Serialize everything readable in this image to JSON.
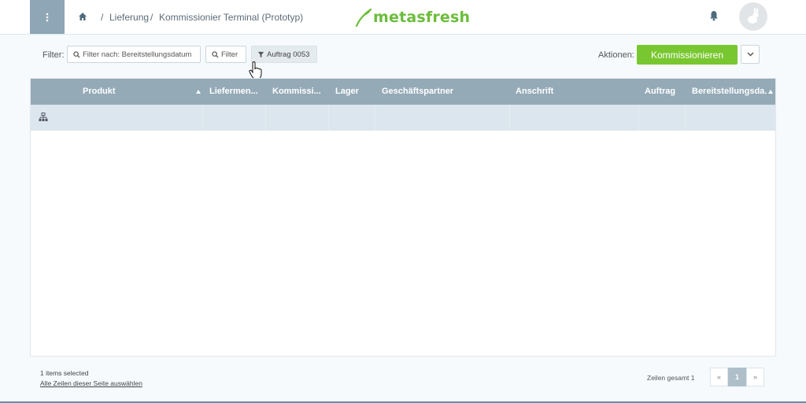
{
  "header": {
    "breadcrumb": [
      "Lieferung",
      "Kommissionier Terminal (Prototyp)"
    ],
    "logo": "metasfresh"
  },
  "toolbar": {
    "filter_label": "Filter:",
    "filter_date": "Filter nach: Bereitstellungsdatum",
    "filter_button": "Filter",
    "active_filter": "Auftrag 0053",
    "actions_label": "Aktionen:",
    "primary_action": "Kommissionieren"
  },
  "table": {
    "columns": [
      "Produkt",
      "Liefermen...",
      "Kommissi...",
      "Lager",
      "Geschäftspartner",
      "Anschrift",
      "Auftrag",
      "Bereitstellungsda..."
    ],
    "rows": [
      [
        "",
        "",
        "",
        "",
        "",
        "",
        "",
        ""
      ]
    ]
  },
  "footer": {
    "selected_info": "1 items selected",
    "select_all": "Alle Zeilen dieser Seite auswählen",
    "total": "Zeilen gesamt 1",
    "prev": "«",
    "page": "1",
    "next": "»"
  },
  "colors": {
    "accent": "#79c730",
    "header_bg": "#95aab7",
    "selected_row": "#dbe6ee",
    "menu_bg": "#8ea6b5"
  },
  "icons": [
    "menu-icon",
    "home-icon",
    "bell-icon",
    "avatar-icon",
    "search-icon",
    "filter-icon",
    "chevron-down-icon",
    "tree-icon",
    "hand-cursor-icon"
  ]
}
